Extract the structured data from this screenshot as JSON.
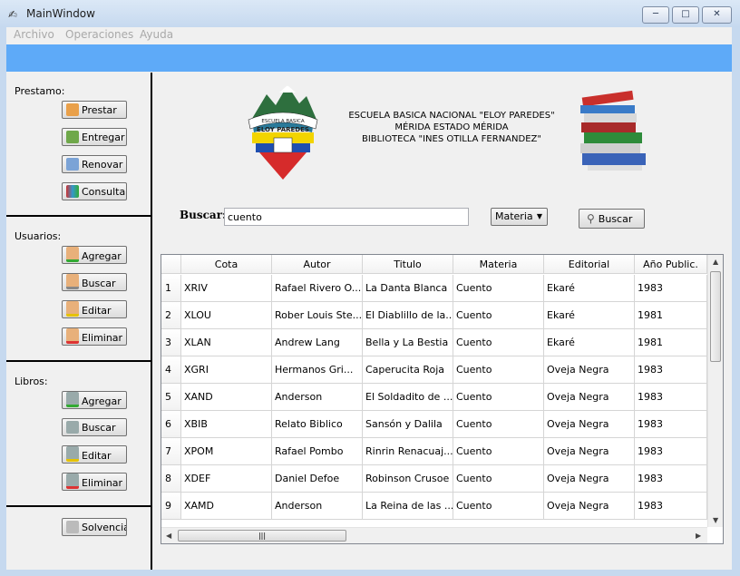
{
  "window": {
    "title": "MainWindow",
    "icon": "app-icon"
  },
  "menu": [
    "Archivo",
    "Operaciones",
    "Ayuda"
  ],
  "colors": {
    "accent_bar": "#5eaaf8",
    "separator": "#000000"
  },
  "sections": {
    "prestamo": {
      "label": "Prestamo:",
      "buttons": [
        "Prestar",
        "Entregar",
        "Renovar",
        "Consultar"
      ]
    },
    "usuarios": {
      "label": "Usuarios:",
      "buttons": [
        "Agregar",
        "Buscar",
        "Editar",
        "Eliminar"
      ]
    },
    "libros": {
      "label": "Libros:",
      "buttons": [
        "Agregar",
        "Buscar",
        "Editar",
        "Eliminar"
      ]
    },
    "solvencia": {
      "button": "Solvencia"
    }
  },
  "header": {
    "line1": "ESCUELA BASICA NACIONAL \"ELOY PAREDES\"",
    "line2": "MÉRIDA ESTADO MÉRIDA",
    "line3": "BIBLIOTECA \"INES OTILLA FERNANDEZ\"",
    "logo_text_top": "ESCUELA BASICA",
    "logo_text_main": "ELOY PAREDES"
  },
  "search": {
    "label": "Buscar:",
    "value": "cuento",
    "combo_value": "Materia",
    "button": "Buscar"
  },
  "table": {
    "columns": [
      "Cota",
      "Autor",
      "Titulo",
      "Materia",
      "Editorial",
      "Año Public."
    ],
    "rows": [
      {
        "n": "1",
        "cells": [
          "XRIV",
          "Rafael Rivero O...",
          "La Danta Blanca",
          "Cuento",
          "Ekaré",
          "1983"
        ]
      },
      {
        "n": "2",
        "cells": [
          "XLOU",
          "Rober Louis Ste...",
          "El Diablillo de la...",
          "Cuento",
          "Ekaré",
          "1981"
        ]
      },
      {
        "n": "3",
        "cells": [
          "XLAN",
          "Andrew Lang",
          "Bella y La Bestia",
          "Cuento",
          "Ekaré",
          "1981"
        ]
      },
      {
        "n": "4",
        "cells": [
          "XGRI",
          "Hermanos Gri...",
          "Caperucita Roja",
          "Cuento",
          "Oveja Negra",
          "1983"
        ]
      },
      {
        "n": "5",
        "cells": [
          "XAND",
          "Anderson",
          "El Soldadito de ...",
          "Cuento",
          "Oveja Negra",
          "1983"
        ]
      },
      {
        "n": "6",
        "cells": [
          "XBIB",
          "Relato Biblico",
          "Sansón y Dalila",
          "Cuento",
          "Oveja Negra",
          "1983"
        ]
      },
      {
        "n": "7",
        "cells": [
          "XPOM",
          "Rafael Pombo",
          "Rinrin Renacuaj...",
          "Cuento",
          "Oveja Negra",
          "1983"
        ]
      },
      {
        "n": "8",
        "cells": [
          "XDEF",
          "Daniel Defoe",
          "Robinson Crusoe",
          "Cuento",
          "Oveja Negra",
          "1983"
        ]
      },
      {
        "n": "9",
        "cells": [
          "XAMD",
          "Anderson",
          "La Reina de las ...",
          "Cuento",
          "Oveja Negra",
          "1983"
        ]
      }
    ]
  }
}
